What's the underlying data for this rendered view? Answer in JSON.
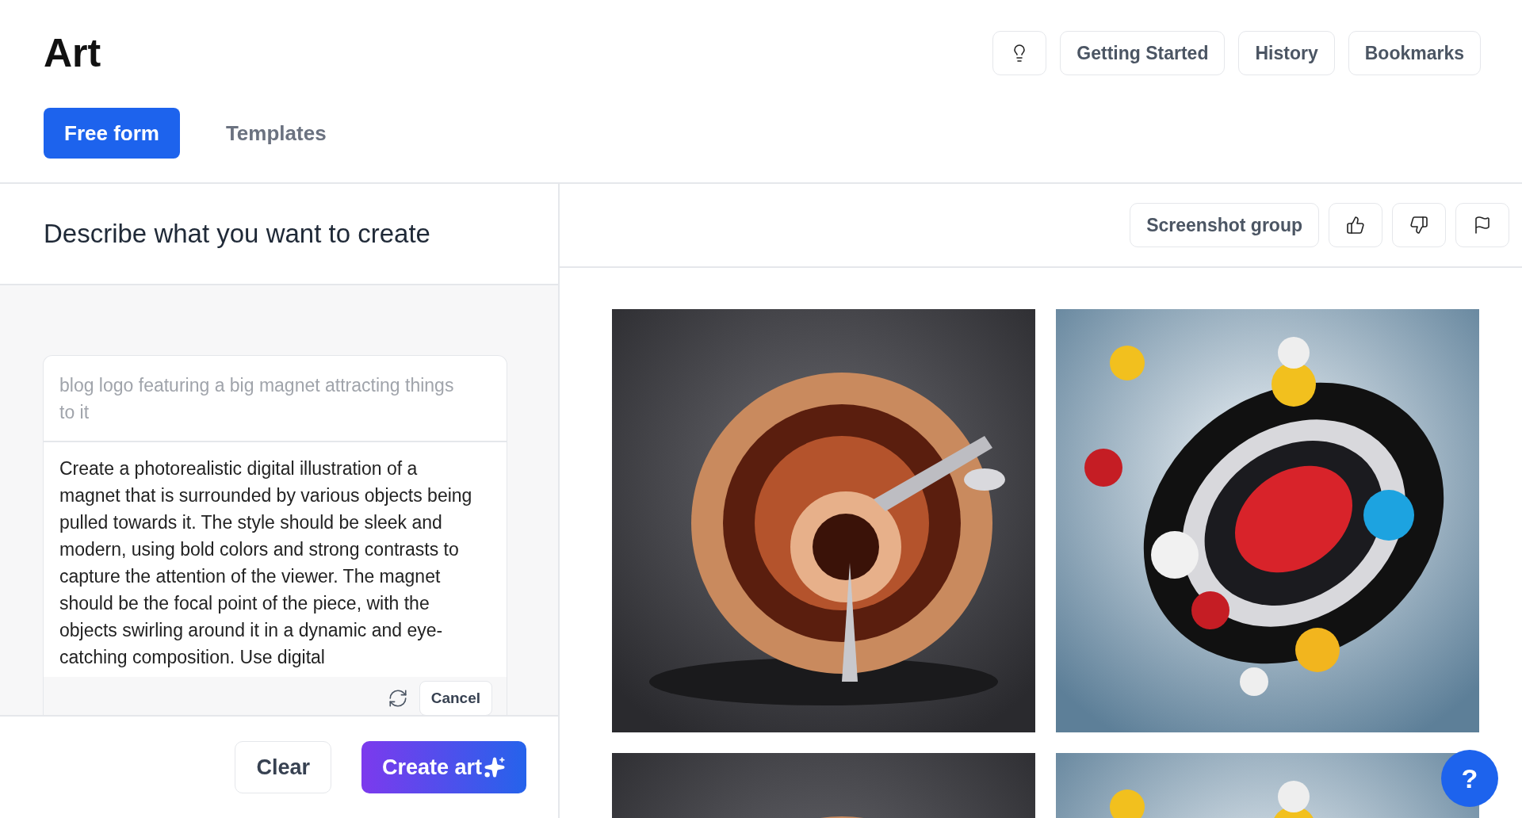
{
  "title": "Art",
  "header_buttons": [
    {
      "kind": "icon"
    },
    {
      "kind": "text",
      "label": "Getting Started"
    },
    {
      "kind": "text",
      "label": "History"
    },
    {
      "kind": "text",
      "label": "Bookmarks"
    }
  ],
  "tabs": [
    {
      "label": "Free form",
      "selected": true
    },
    {
      "label": "Templates",
      "selected": false
    }
  ],
  "left_panel": {
    "heading": "Describe what you want to create",
    "prompt": {
      "placeholder": "blog logo featuring a big magnet attracting things to it"
    },
    "generated_text": "Create a photorealistic digital illustration of a magnet that is surrounded by various objects being pulled towards it. The style should be sleek and modern, using bold colors and strong contrasts to capture the attention of the viewer. The magnet should be the focal point of the piece, with the objects swirling around it in a dynamic and eye-catching composition. Use digital",
    "cancel_button": "Cancel",
    "clear_button": "Clear",
    "create_button": "Create art"
  },
  "right_panel": {
    "toolbar": [
      {
        "kind": "text",
        "label": "Screenshot group"
      },
      {
        "kind": "icon"
      },
      {
        "kind": "icon"
      },
      {
        "kind": "icon"
      }
    ],
    "help_button": "?"
  }
}
